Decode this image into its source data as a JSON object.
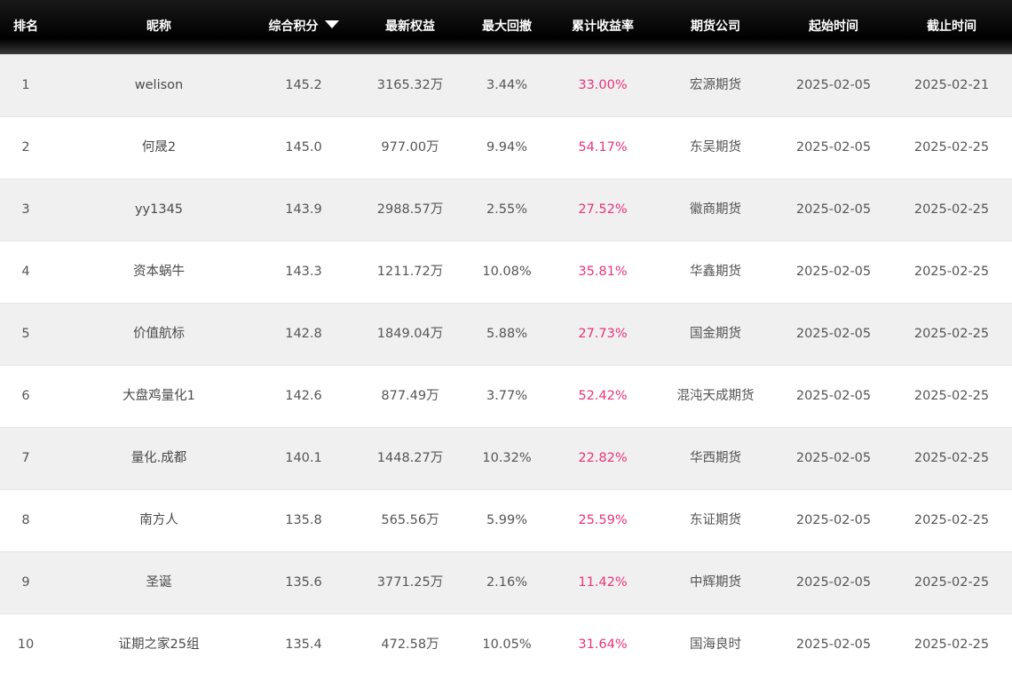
{
  "header": {
    "rank": "排名",
    "name": "昵称",
    "score": "综合积分",
    "equity": "最新权益",
    "drawdown": "最大回撤",
    "return": "累计收益率",
    "company": "期货公司",
    "start": "起始时间",
    "end": "截止时间",
    "sort_icon": "sort-desc-triangle-icon"
  },
  "colors": {
    "header_bg": "#000000",
    "row_odd": "#f0f0f0",
    "row_even": "#ffffff",
    "return_text": "#e8347a"
  },
  "rows": [
    {
      "rank": "1",
      "name": "welison",
      "score": "145.2",
      "equity": "3165.32万",
      "drawdown": "3.44%",
      "return": "33.00%",
      "company": "宏源期货",
      "start": "2025-02-05",
      "end": "2025-02-21"
    },
    {
      "rank": "2",
      "name": "何晟2",
      "score": "145.0",
      "equity": "977.00万",
      "drawdown": "9.94%",
      "return": "54.17%",
      "company": "东吴期货",
      "start": "2025-02-05",
      "end": "2025-02-25"
    },
    {
      "rank": "3",
      "name": "yy1345",
      "score": "143.9",
      "equity": "2988.57万",
      "drawdown": "2.55%",
      "return": "27.52%",
      "company": "徽商期货",
      "start": "2025-02-05",
      "end": "2025-02-25"
    },
    {
      "rank": "4",
      "name": "资本蜗牛",
      "score": "143.3",
      "equity": "1211.72万",
      "drawdown": "10.08%",
      "return": "35.81%",
      "company": "华鑫期货",
      "start": "2025-02-05",
      "end": "2025-02-25"
    },
    {
      "rank": "5",
      "name": "价值航标",
      "score": "142.8",
      "equity": "1849.04万",
      "drawdown": "5.88%",
      "return": "27.73%",
      "company": "国金期货",
      "start": "2025-02-05",
      "end": "2025-02-25"
    },
    {
      "rank": "6",
      "name": "大盘鸡量化1",
      "score": "142.6",
      "equity": "877.49万",
      "drawdown": "3.77%",
      "return": "52.42%",
      "company": "混沌天成期货",
      "start": "2025-02-05",
      "end": "2025-02-25"
    },
    {
      "rank": "7",
      "name": "量化.成都",
      "score": "140.1",
      "equity": "1448.27万",
      "drawdown": "10.32%",
      "return": "22.82%",
      "company": "华西期货",
      "start": "2025-02-05",
      "end": "2025-02-25"
    },
    {
      "rank": "8",
      "name": "南方人",
      "score": "135.8",
      "equity": "565.56万",
      "drawdown": "5.99%",
      "return": "25.59%",
      "company": "东证期货",
      "start": "2025-02-05",
      "end": "2025-02-25"
    },
    {
      "rank": "9",
      "name": "圣诞",
      "score": "135.6",
      "equity": "3771.25万",
      "drawdown": "2.16%",
      "return": "11.42%",
      "company": "中辉期货",
      "start": "2025-02-05",
      "end": "2025-02-25"
    },
    {
      "rank": "10",
      "name": "证期之家25组",
      "score": "135.4",
      "equity": "472.58万",
      "drawdown": "10.05%",
      "return": "31.64%",
      "company": "国海良时",
      "start": "2025-02-05",
      "end": "2025-02-25"
    }
  ]
}
